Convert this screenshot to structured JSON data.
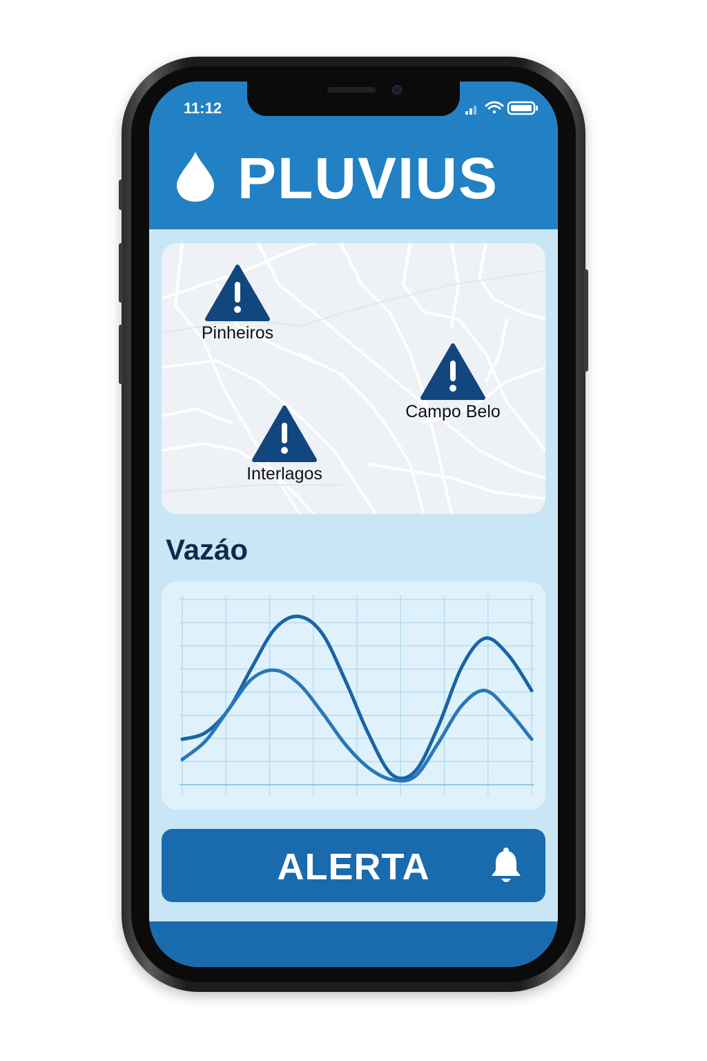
{
  "status_bar": {
    "time": "11:12"
  },
  "header": {
    "app_name": "PLUVIUS",
    "logo_icon": "water-drop-icon"
  },
  "map": {
    "markers": [
      {
        "label": "Pinheiros",
        "icon": "warning-triangle-icon"
      },
      {
        "label": "Campo Belo",
        "icon": "warning-triangle-icon"
      },
      {
        "label": "Interlagos",
        "icon": "warning-triangle-icon"
      }
    ]
  },
  "flow_section": {
    "title": "Vazáo"
  },
  "chart_data": {
    "type": "line",
    "title": "",
    "xlabel": "",
    "ylabel": "",
    "grid": true,
    "x": [
      0,
      1,
      2,
      3,
      4,
      5,
      6,
      7,
      8,
      9,
      10,
      11,
      12,
      13,
      14,
      15
    ],
    "series": [
      {
        "values": [
          0.27,
          0.31,
          0.45,
          0.7,
          0.93,
          1.0,
          0.9,
          0.62,
          0.3,
          0.06,
          0.08,
          0.35,
          0.7,
          0.87,
          0.77,
          0.56
        ]
      },
      {
        "values": [
          0.15,
          0.26,
          0.45,
          0.63,
          0.68,
          0.6,
          0.43,
          0.24,
          0.1,
          0.03,
          0.05,
          0.25,
          0.47,
          0.56,
          0.44,
          0.27
        ]
      }
    ],
    "ylim": [
      0,
      1.1
    ],
    "colors": [
      "#1a63a6",
      "#2a77b8"
    ]
  },
  "alert_button": {
    "label": "ALERTA",
    "icon": "bell-icon"
  },
  "colors": {
    "header": "#2181c4",
    "background": "#c8e6f5",
    "warning_marker": "#12467e",
    "button": "#1a6aae"
  }
}
